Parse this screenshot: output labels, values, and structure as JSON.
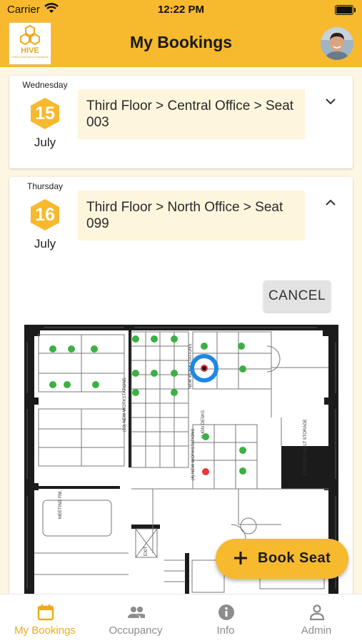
{
  "status_bar": {
    "carrier": "Carrier",
    "time": "12:22 PM"
  },
  "header": {
    "title": "My Bookings",
    "logo_text": "HIVE",
    "logo_subtitle": "HYBRID WORKSPACE EXPERIENCE"
  },
  "bookings": [
    {
      "weekday": "Wednesday",
      "day": "15",
      "month": "July",
      "location": "Third Floor > Central Office > Seat 003",
      "expanded": false
    },
    {
      "weekday": "Thursday",
      "day": "16",
      "month": "July",
      "location": "Third Floor > North Office > Seat 099",
      "expanded": true
    }
  ],
  "floor_plan": {
    "cancel_label": "CANCEL",
    "room_labels": {
      "meeting": "MEETING RM.",
      "exit": "EXIT",
      "storage": "EXISTING VAULT STORAGE",
      "new_workstations_a": "(10) NEW WORKSTATIONS",
      "new_workstations_b": "(4) NEW WORKSTATIONS",
      "new_workstations_c": "NEW WORKSTATIONS",
      "align_desks": "ALIGN DESKS"
    },
    "seat_available_color": "#3cb043",
    "seat_booked_color": "#e53935",
    "selected_ring_color": "#1e88e5"
  },
  "fab": {
    "label": "Book Seat",
    "icon": "plus-icon"
  },
  "tabs": [
    {
      "label": "My Bookings",
      "icon": "calendar-icon",
      "active": true
    },
    {
      "label": "Occupancy",
      "icon": "people-icon",
      "active": false
    },
    {
      "label": "Info",
      "icon": "info-icon",
      "active": false
    },
    {
      "label": "Admin",
      "icon": "person-icon",
      "active": false
    }
  ],
  "colors": {
    "accent": "#f7b92e",
    "active_tab": "#f0a91a",
    "inactive_tab": "#8c8c8c"
  }
}
